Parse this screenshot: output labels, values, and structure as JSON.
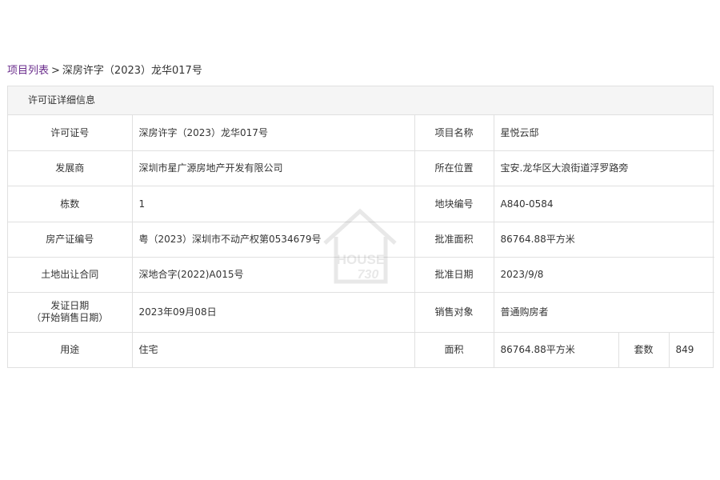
{
  "breadcrumb": {
    "parent": "项目列表",
    "separator": ">",
    "current": "深房许字（2023）龙华017号"
  },
  "panel": {
    "title": "许可证详细信息"
  },
  "rows": [
    {
      "label1": "许可证号",
      "value1": "深房许字（2023）龙华017号",
      "label2": "项目名称",
      "value2": "星悦云邸"
    },
    {
      "label1": "发展商",
      "value1": "深圳市星广源房地产开发有限公司",
      "label2": "所在位置",
      "value2": "宝安.龙华区大浪街道浮罗路旁"
    },
    {
      "label1": "栋数",
      "value1": "1",
      "label2": "地块编号",
      "value2": "A840-0584"
    },
    {
      "label1": "房产证编号",
      "value1": "粤（2023）深圳市不动产权第0534679号",
      "label2": "批准面积",
      "value2": "86764.88平方米"
    },
    {
      "label1": "土地出让合同",
      "value1": "深地合字(2022)A015号",
      "label2": "批准日期",
      "value2": "2023/9/8"
    },
    {
      "label1_line1": "发证日期",
      "label1_line2": "（开始销售日期）",
      "value1": "2023年09月08日",
      "label2": "销售对象",
      "value2": "普通购房者"
    }
  ],
  "last_row": {
    "label1": "用途",
    "value1": "住宅",
    "label2": "面积",
    "value2": "86764.88平方米",
    "label3": "套数",
    "value3": "849"
  },
  "watermark": {
    "icon": "house-logo-icon",
    "text_line1": "HOUSE",
    "text_line2": "730",
    "color": "#9a9a9a"
  },
  "colors": {
    "link": "#6a2c8c",
    "border": "#e0e0e0",
    "header_bg": "#f5f5f5"
  }
}
